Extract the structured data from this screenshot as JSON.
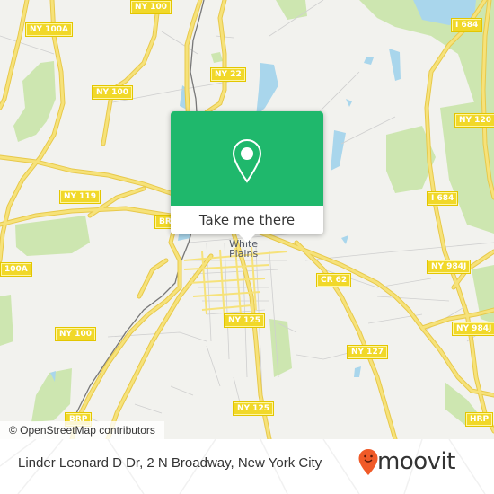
{
  "map": {
    "attribution": "© OpenStreetMap contributors",
    "city_label_line1": "White",
    "city_label_line2": "Plains",
    "colors": {
      "land": "#f2f2ee",
      "road": "#f6e27a",
      "road_casing": "#e8c94a",
      "park": "#cde6b0",
      "water": "#a9d6ec",
      "rail": "#777777",
      "minor_road": "#cfcfcf",
      "shield": "#f1d829"
    },
    "route_shields": [
      {
        "label": "NY 100",
        "id": "ny100-top"
      },
      {
        "label": "NY 100A",
        "id": "ny100a-top"
      },
      {
        "label": "NY 100",
        "id": "ny100-mid"
      },
      {
        "label": "NY 22",
        "id": "ny22"
      },
      {
        "label": "I 684",
        "id": "i684-top"
      },
      {
        "label": "NY 120",
        "id": "ny120"
      },
      {
        "label": "I 684",
        "id": "i684-mid"
      },
      {
        "label": "NY 119",
        "id": "ny119"
      },
      {
        "label": "BRP",
        "id": "brp-mid"
      },
      {
        "label": "100A",
        "id": "ny100a-left"
      },
      {
        "label": "NY 984J",
        "id": "ny984j-top"
      },
      {
        "label": "CR 62",
        "id": "cr62"
      },
      {
        "label": "NY 984J",
        "id": "ny984j-right"
      },
      {
        "label": "NY 125",
        "id": "ny125-mid"
      },
      {
        "label": "NY 100",
        "id": "ny100-low"
      },
      {
        "label": "NY 127",
        "id": "ny127"
      },
      {
        "label": "NY 125",
        "id": "ny125-low"
      },
      {
        "label": "BRP",
        "id": "brp-low"
      },
      {
        "label": "HRP",
        "id": "hrp"
      }
    ]
  },
  "popup": {
    "icon": "map-pin-icon",
    "button_label": "Take me there",
    "color": "#1fb86c"
  },
  "footer": {
    "address": "Linder Leonard D Dr, 2 N Broadway, New York City",
    "brand": "moovit",
    "brand_icon": "moovit-logo-icon",
    "brand_color": "#f05a28"
  }
}
